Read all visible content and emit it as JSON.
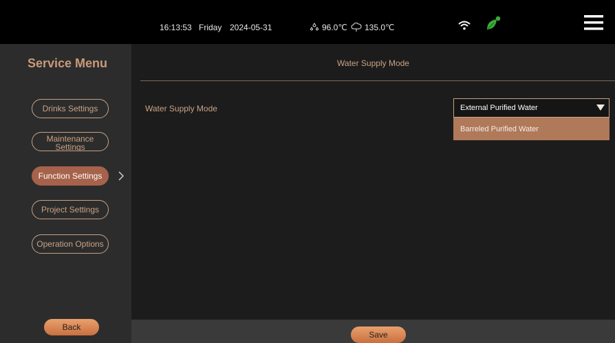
{
  "status_bar": {
    "time": "16:13:53",
    "day": "Friday",
    "date": "2024-05-31",
    "temp1": "96.0℃",
    "temp1_icon": "water-drops-icon",
    "temp2": "135.0℃",
    "temp2_icon": "steam-cloud-icon",
    "wifi_icon": "wifi-icon",
    "leaf_icon": "leaf-notification-icon",
    "menu_icon": "hamburger-menu-icon"
  },
  "sidebar": {
    "title": "Service Menu",
    "items": [
      {
        "label": "Drinks Settings"
      },
      {
        "label": "Maintenance Settings"
      },
      {
        "label": "Function Settings"
      },
      {
        "label": "Project Settings"
      },
      {
        "label": "Operation Options"
      }
    ],
    "active_index": 2,
    "back_label": "Back"
  },
  "main": {
    "heading": "Water Supply Mode",
    "field_label": "Water Supply Mode",
    "select": {
      "value": "External Purified Water",
      "options": [
        "Barreled Purified Water"
      ]
    },
    "save_label": "Save"
  },
  "colors": {
    "accent": "#c9a384",
    "active": "#a6624a",
    "button": "#e08a55",
    "leaf": "#3daa3a"
  }
}
